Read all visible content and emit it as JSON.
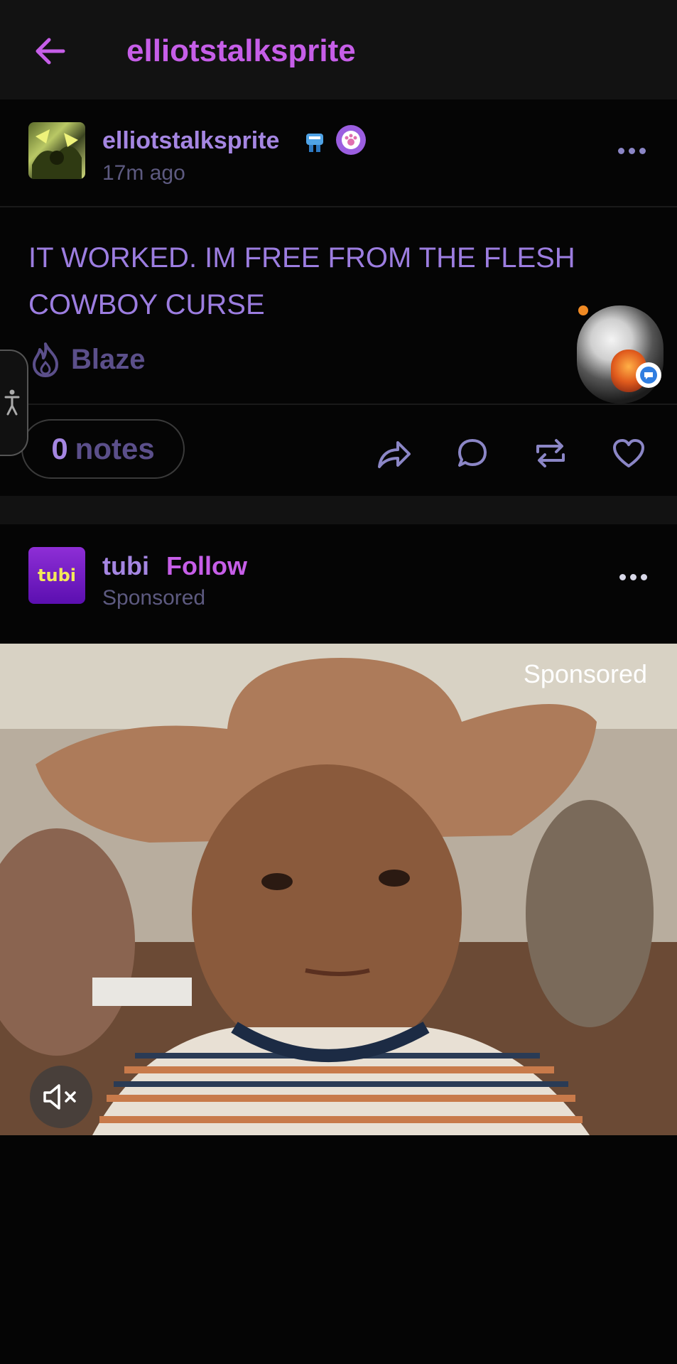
{
  "header": {
    "title": "elliotstalksprite",
    "back_icon": "arrow-left-icon"
  },
  "post": {
    "username": "elliotstalksprite",
    "timestamp": "17m ago",
    "text": "IT WORKED. IM FREE FROM THE FLESH COWBOY CURSE",
    "blaze_label": "Blaze",
    "notes_count": "0",
    "notes_label": "notes",
    "actions": [
      "share-icon",
      "reply-icon",
      "reblog-icon",
      "like-icon"
    ]
  },
  "ad": {
    "advertiser": "tubi",
    "advertiser_logo_text": "tubi",
    "follow_label": "Follow",
    "subtitle": "Sponsored",
    "media_label": "Sponsored"
  },
  "colors": {
    "accent": "#c65ee8",
    "text_primary": "#a586e2",
    "text_muted": "#5d5a80",
    "background": "#050505",
    "bar": "#121212"
  }
}
